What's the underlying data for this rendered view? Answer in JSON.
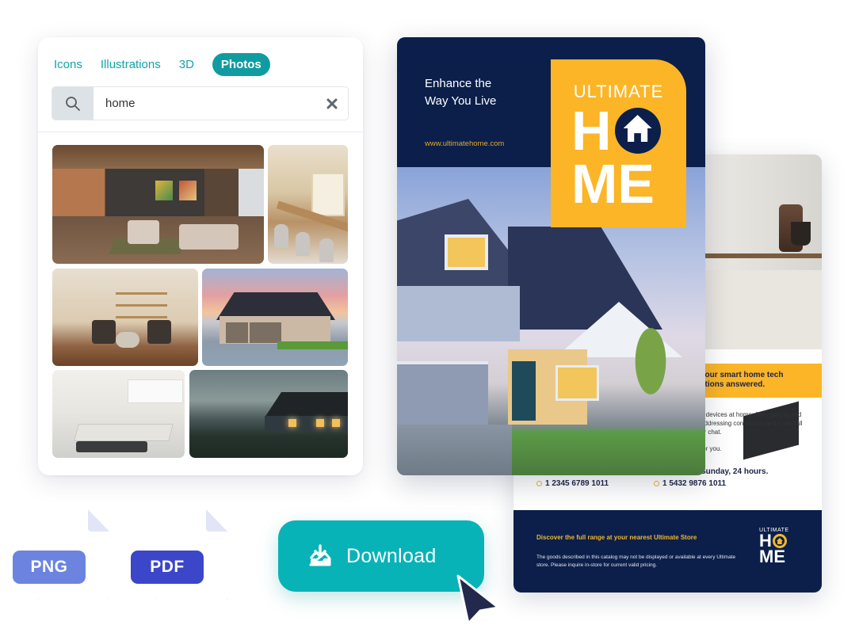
{
  "panel": {
    "tabs": [
      {
        "label": "Icons",
        "active": false
      },
      {
        "label": "Illustrations",
        "active": false
      },
      {
        "label": "3D",
        "active": false
      },
      {
        "label": "Photos",
        "active": true
      }
    ],
    "search": {
      "value": "home",
      "icon": "search-icon",
      "clear_icon": "close-icon"
    },
    "results": [
      {
        "subject": "living room interior"
      },
      {
        "subject": "dining area with pendant lights"
      },
      {
        "subject": "boho living room with shelves"
      },
      {
        "subject": "suburban house at sunset"
      },
      {
        "subject": "white kitchen with island"
      },
      {
        "subject": "house on hill at dusk"
      }
    ]
  },
  "front_brochure": {
    "tagline_line1": "Enhance the",
    "tagline_line2": "Way You Live",
    "url": "www.ultimatehome.com",
    "logo": {
      "top": "ULTIMATE",
      "row1": "H",
      "row2": "ME"
    },
    "colors": {
      "navy": "#0b1f4a",
      "yellow": "#fbb526"
    }
  },
  "back_brochure": {
    "banner": "your smart home tech stions answered.",
    "body_line1": "d devices at home: from pairing and addressing connection and s via call or chat.",
    "body_line2": "for you.",
    "hours": "Sunday, 24 hours.",
    "phone1": "1 2345 6789 1011",
    "phone2": "1 5432 9876 1011",
    "footer_title": "Discover the full range at your nearest Ultimate Store",
    "footer_note": "The goods described in this catalog may not be displayed or available at every Ultimate store. Please inquire in-store for current valid pricing.",
    "logo": {
      "top": "ULTIMATE",
      "row1": "H",
      "row2": "ME"
    }
  },
  "export": {
    "formats": [
      {
        "label": "PNG",
        "color": "#6c84e0"
      },
      {
        "label": "PDF",
        "color": "#3b46c9"
      }
    ],
    "download_label": "Download",
    "download_color": "#08b3b8"
  }
}
